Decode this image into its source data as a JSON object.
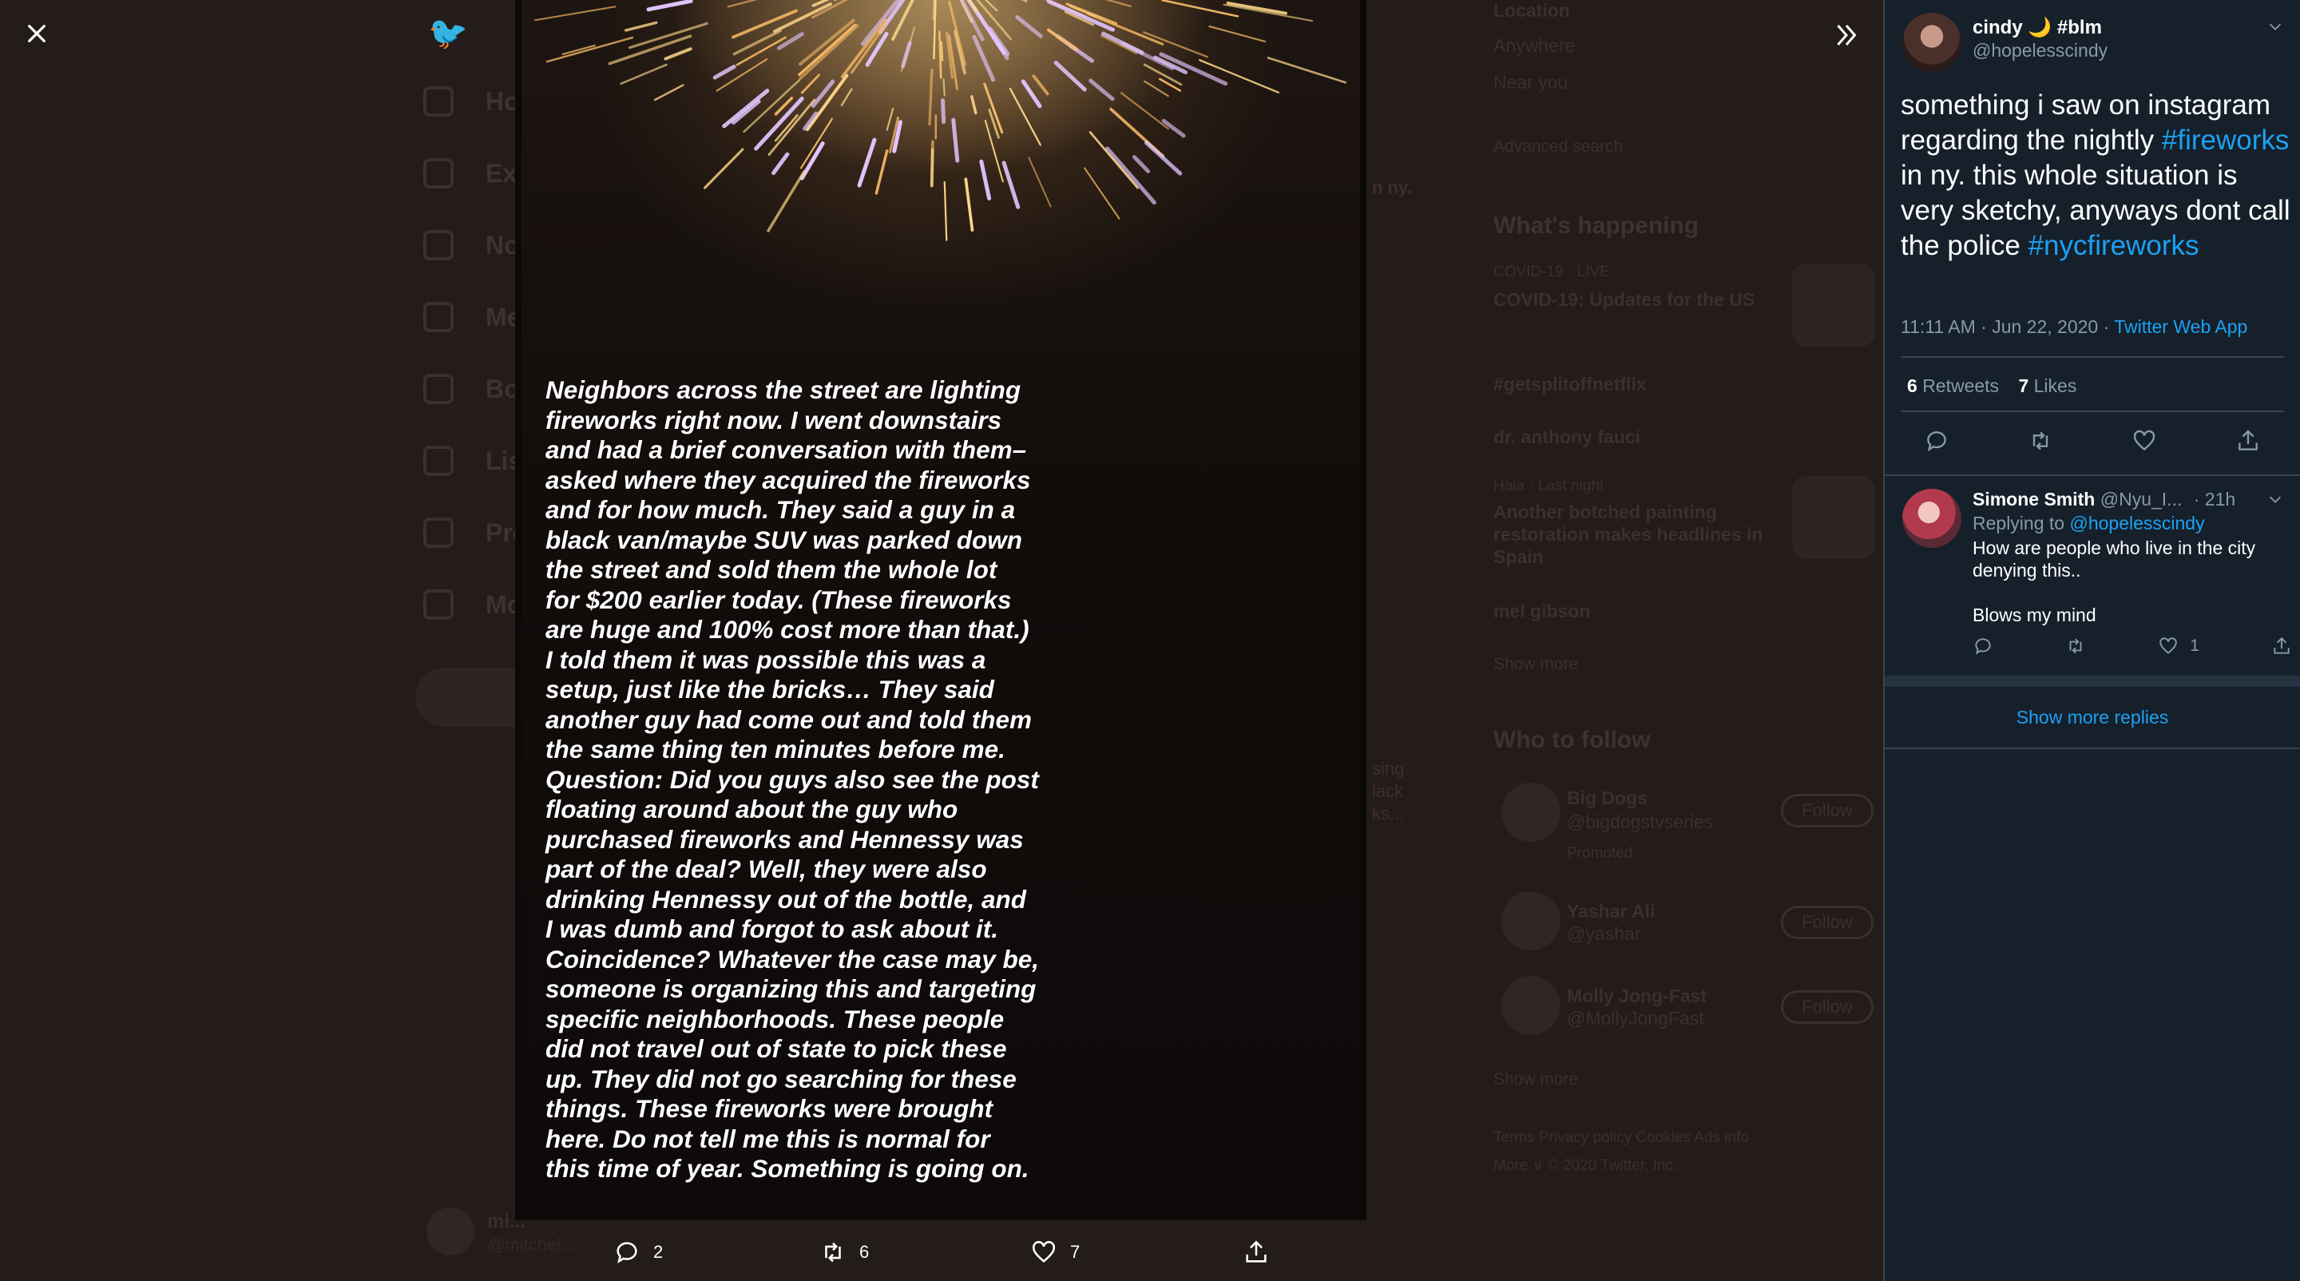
{
  "background": {
    "nav": [
      "Ho",
      "Ex",
      "No",
      "Me",
      "Bo",
      "Lis",
      "Pro",
      "Mo"
    ],
    "bottom_user": {
      "name": "mi...",
      "handle": "@mitchel..."
    },
    "right": {
      "location_header": "Location",
      "location_anywhere": "Anywhere",
      "location_near": "Near you",
      "advanced": "Advanced search",
      "whats_happening": "What's happening",
      "trend1_meta": "COVID-19 · LIVE",
      "trend1_title": "COVID-19: Updates for the US",
      "trend2": "#getsplitoffnetflix",
      "trend3": "dr. anthony fauci",
      "trend4_meta": "Hala · Last night",
      "trend4_title_1": "Another botched painting",
      "trend4_title_2": "restoration makes headlines in",
      "trend4_title_3": "Spain",
      "trend5": "mel gibson",
      "show_more": "Show more",
      "who_to_follow": "Who to follow",
      "follow1_name": "Big Dogs",
      "follow1_handle": "@bigdogstvseries",
      "follow1_promoted": "Promoted",
      "follow2_name": "Yashar Ali",
      "follow2_handle": "@yashar",
      "follow3_name": "Molly Jong-Fast",
      "follow3_handle": "@MollyJongFast",
      "follow_label": "Follow",
      "show_more2": "Show more",
      "footer1": "Terms   Privacy policy   Cookies   Ads info",
      "footer2": "More ∨   © 2020 Twitter, Inc."
    },
    "middle_fragments": [
      "n ny.",
      "sing",
      "lack",
      "ks..."
    ]
  },
  "viewer": {
    "close_icon": "close-icon",
    "expand_icon": "chevrons-right-icon",
    "story_text": "Neighbors across the street are lighting\nfireworks right now. I went downstairs\nand had a brief conversation with them–\nasked where they acquired the fireworks\nand for how much. They said a guy in a\nblack van/maybe SUV was parked down\nthe street and sold them the whole lot\nfor $200 earlier today. (These fireworks\nare huge and 100% cost more than that.)\nI told them it was possible this was a\nsetup, just like the bricks… They said\nanother guy had come out and told them\nthe same thing ten minutes before me.\nQuestion: Did you guys also see the post\nfloating around about the guy who\npurchased fireworks and Hennessy was\npart of the deal? Well, they were also\ndrinking Hennessy out of the bottle, and\nI was dumb and forgot to ask about it.\nCoincidence? Whatever the case may be,\nsomeone is organizing this and targeting\nspecific neighborhoods. These people\ndid not travel out of state to pick these\nup. They did not go searching for these\nthings. These fireworks were brought\nhere. Do not tell me this is normal for\nthis time of year. Something is going on.",
    "actions": {
      "replies": "2",
      "retweets": "6",
      "likes": "7"
    }
  },
  "tweet": {
    "name": "cindy 🌙 #blm",
    "handle": "@hopelesscindy",
    "text_parts": {
      "p1": "something i saw on instagram regarding the nightly ",
      "tag1": "#fireworks",
      "p2": " in ny. this whole situation is very sketchy, anyways dont call the police ",
      "tag2": "#nycfireworks"
    },
    "time": "11:11 AM · Jun 22, 2020 · ",
    "source": "Twitter Web App",
    "retweets_count": "6",
    "retweets_label": "Retweets",
    "likes_count": "7",
    "likes_label": "Likes"
  },
  "reply": {
    "name": "Simone Smith",
    "handle": "@Nyu_I...",
    "age": "· 21h",
    "replying_to_label": "Replying to ",
    "replying_to": "@hopelesscindy",
    "body": "How are people who live in the city denying this..\n\nBlows my mind",
    "likes": "1"
  },
  "show_more_replies": "Show more replies",
  "colors": {
    "accent": "#1da1f2",
    "sidebar_bg": "#15202b",
    "muted": "#8899a6"
  }
}
